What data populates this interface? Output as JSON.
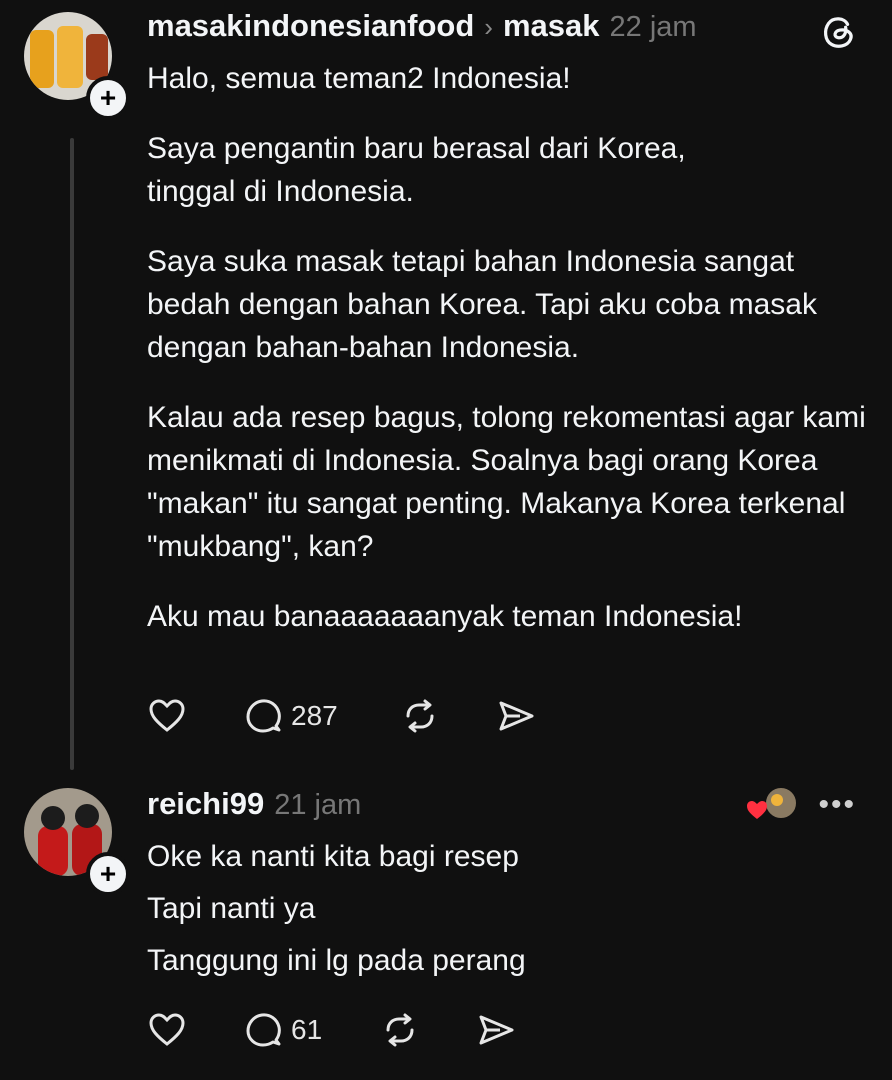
{
  "post": {
    "username": "masakindonesianfood",
    "separator": "›",
    "community": "masak",
    "time": "22 jam",
    "paragraphs": [
      "Halo, semua teman2 Indonesia!",
      "Saya pengantin baru berasal dari Korea, tinggal di Indonesia.",
      "Saya suka masak tetapi bahan Indonesia sangat bedah dengan bahan Korea. Tapi aku coba masak dengan bahan-bahan Indonesia.",
      "Kalau ada resep bagus, tolong rekomentasi agar kami menikmati di Indonesia. Soalnya bagi orang Korea \"makan\" itu sangat penting. Makanya Korea terkenal \"mukbang\", kan?",
      "Aku mau banaaaaaaanyak teman Indonesia!"
    ],
    "reply_count": "287",
    "follow_symbol": "+"
  },
  "reply": {
    "username": "reichi99",
    "time": "21 jam",
    "lines": [
      "Oke ka nanti kita bagi resep",
      "Tapi nanti ya",
      "Tanggung ini lg pada perang"
    ],
    "reply_count": "61",
    "follow_symbol": "+",
    "more_symbol": "•••"
  },
  "colors": {
    "background": "#101010",
    "text": "#f3f5f7",
    "muted": "#777777",
    "like_red": "#ff3040"
  },
  "icons": [
    "threads-logo-icon",
    "heart-icon",
    "comment-icon",
    "repost-icon",
    "share-icon",
    "more-icon",
    "liked-by-author-icon"
  ]
}
